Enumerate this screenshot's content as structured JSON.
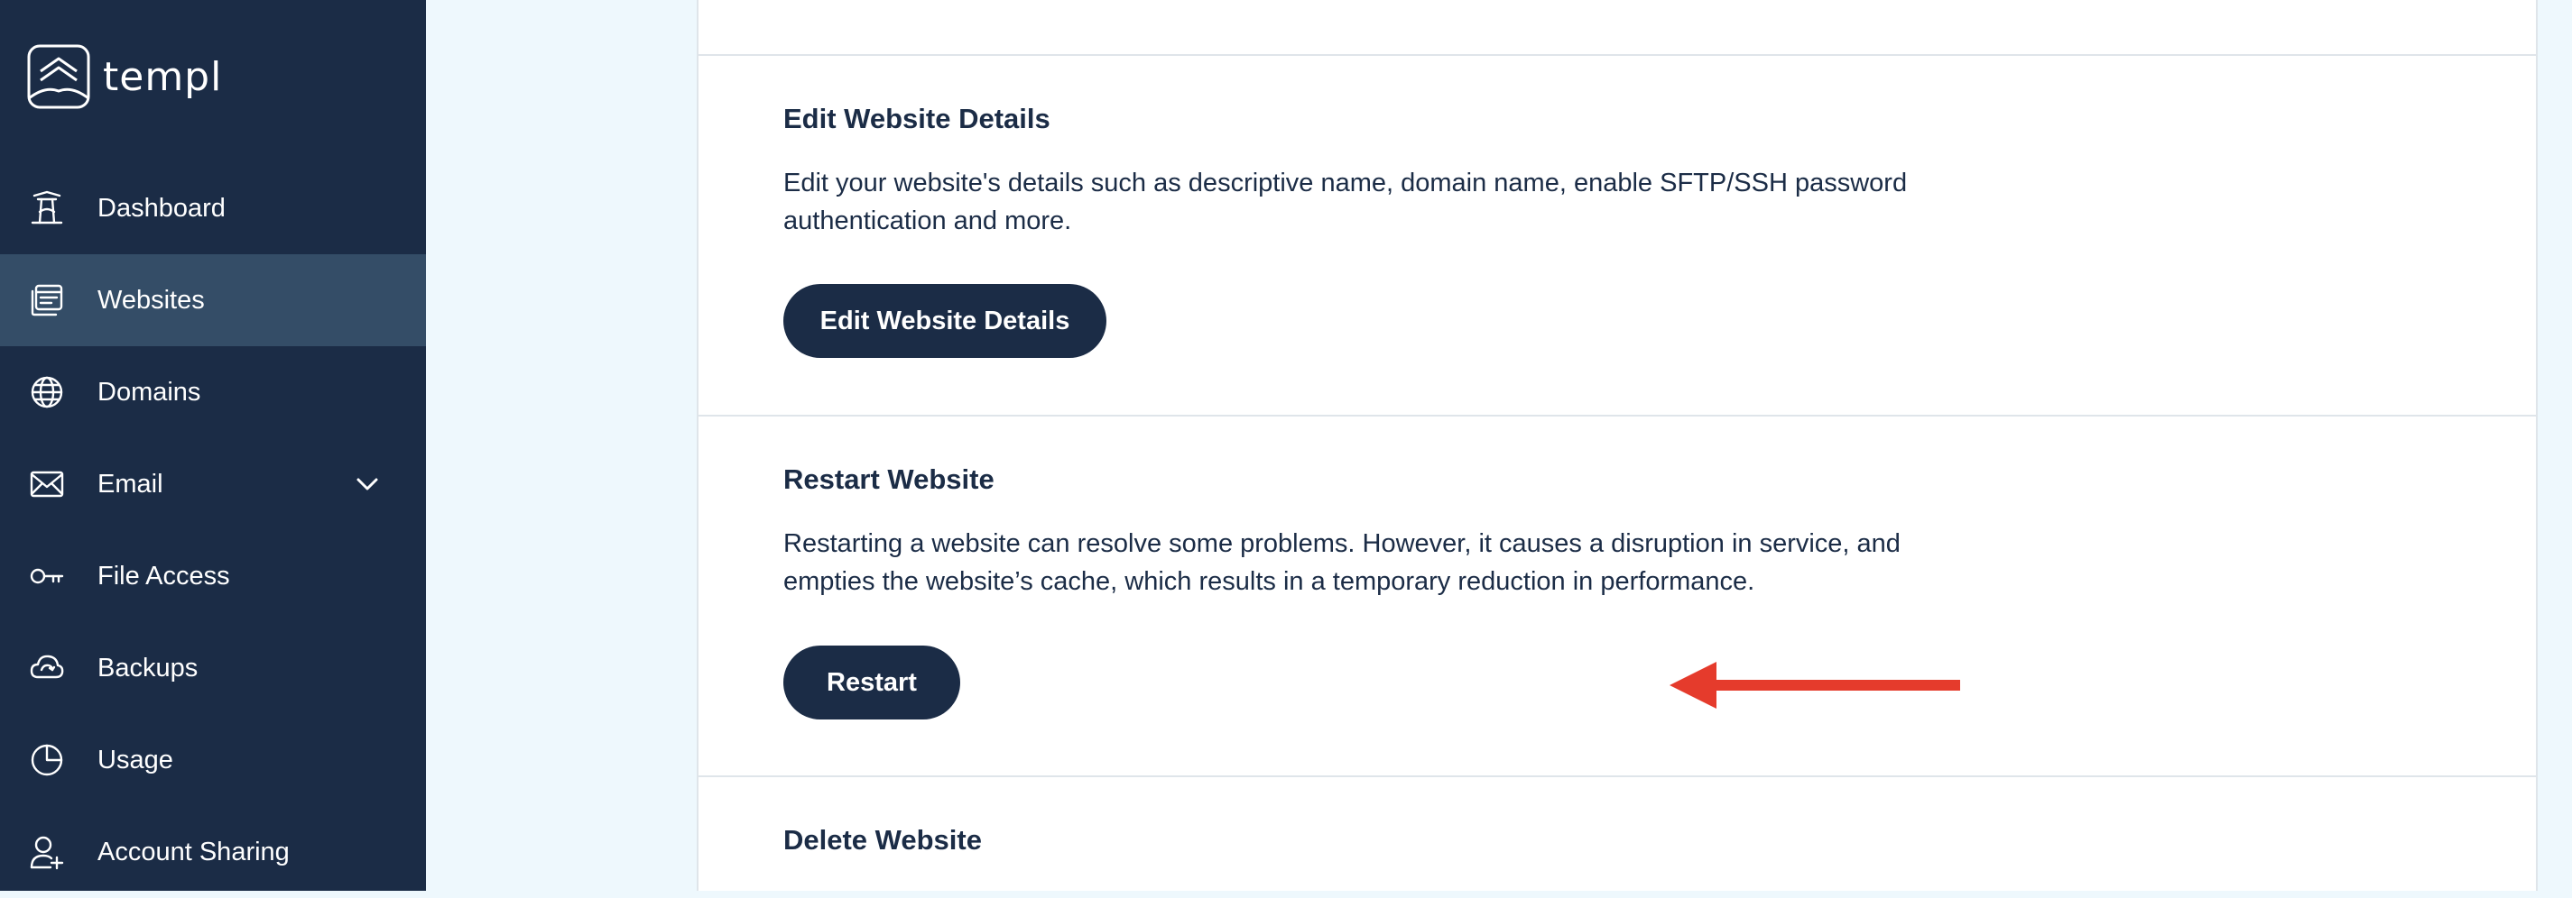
{
  "brand": {
    "name": "templ",
    "logo_icon": "templ-logo-icon"
  },
  "sidebar": {
    "items": [
      {
        "label": "Dashboard",
        "icon": "dashboard-icon",
        "active": false
      },
      {
        "label": "Websites",
        "icon": "websites-icon",
        "active": true
      },
      {
        "label": "Domains",
        "icon": "globe-icon",
        "active": false
      },
      {
        "label": "Email",
        "icon": "mail-icon",
        "active": false,
        "expandable": true
      },
      {
        "label": "File Access",
        "icon": "key-icon",
        "active": false
      },
      {
        "label": "Backups",
        "icon": "cloud-backup-icon",
        "active": false
      },
      {
        "label": "Usage",
        "icon": "pie-chart-icon",
        "active": false
      },
      {
        "label": "Account Sharing",
        "icon": "user-add-icon",
        "active": false
      }
    ]
  },
  "main": {
    "edit_section": {
      "title": "Edit Website Details",
      "description": "Edit your website's details such as descriptive name, domain name, enable SFTP/SSH password authentication and more.",
      "button_label": "Edit Website Details"
    },
    "restart_section": {
      "title": "Restart Website",
      "description": "Restarting a website can resolve some problems. However, it causes a disruption in service, and empties the website’s cache, which results in a temporary reduction in performance.",
      "button_label": "Restart"
    },
    "delete_section": {
      "title": "Delete Website"
    }
  },
  "annotation": {
    "arrow_color": "#e53b2c",
    "arrow_icon": "red-arrow-left-icon"
  },
  "colors": {
    "sidebar_bg": "#1b2c46",
    "sidebar_active_bg": "#344d67",
    "page_bg": "#eef8fd",
    "button_bg": "#1b2c46",
    "text": "#1b2c46"
  }
}
